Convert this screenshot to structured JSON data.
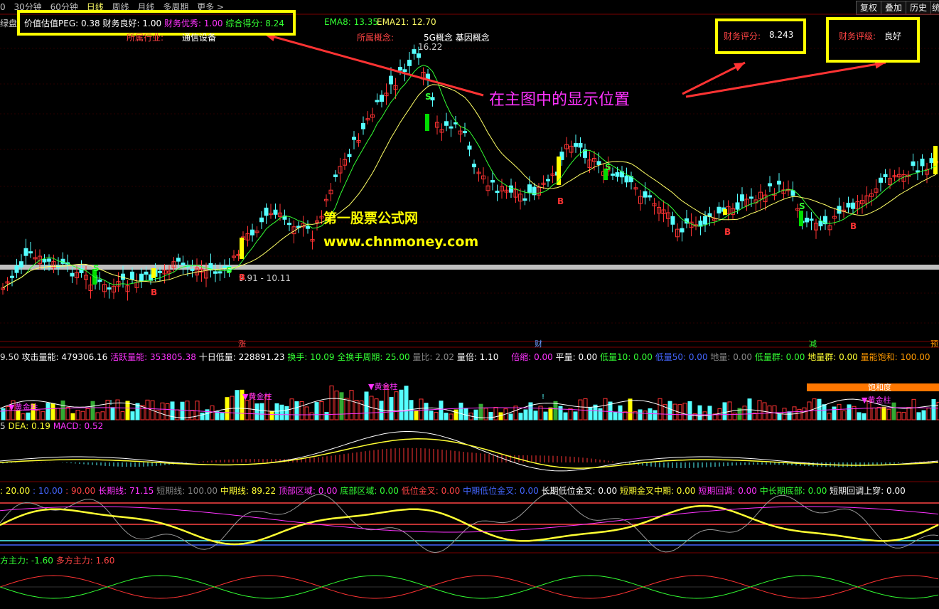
{
  "topbar": {
    "left_label": "0",
    "periods": [
      "30分钟",
      "60分钟",
      "日线",
      "周线",
      "月线",
      "多周期",
      "更多 >"
    ],
    "selected_period": "日线",
    "right_buttons": [
      "复权",
      "叠加",
      "历史",
      "统"
    ]
  },
  "main": {
    "side_label": "绿盘",
    "info_items": [
      {
        "text": "价值估值PEG: 0.38",
        "color": "#ffffff"
      },
      {
        "text": "财务良好: 1.00",
        "color": "#ffffff"
      },
      {
        "text": "财务优秀: 1.00",
        "color": "#ff33ff"
      },
      {
        "text": "综合得分: 8.24",
        "color": "#33ff33"
      }
    ],
    "ema8": "EMA8: 13.35",
    "ema21": "EMA21: 12.70",
    "industry_label": "所属行业:",
    "industry_value": "通信设备",
    "concept_label": "所属概念:",
    "concept_value": "5G概念 基因概念",
    "high_price": "16.22",
    "range_label": "9.91 - 10.11",
    "fin_score_label": "财务评分:",
    "fin_score_value": "8.243",
    "fin_rating_label": "财务评级:",
    "fin_rating_value": "良好",
    "annotation": "在主图中的显示位置",
    "watermark_cn": "第一股票公式网",
    "watermark_url": "www.chnmoney.com",
    "signals": [
      "S",
      "B",
      "S",
      "B",
      "S",
      "B",
      "S",
      "B",
      "S",
      "B"
    ],
    "bottom_tags": [
      "涨",
      "财",
      "减",
      "预"
    ]
  },
  "volume_panel": {
    "items": [
      {
        "text": "9.50",
        "color": "#dddddd"
      },
      {
        "text": "攻击量能: 479306.16",
        "color": "#ffffff"
      },
      {
        "text": "活跃量能: 353805.38",
        "color": "#ff33ff"
      },
      {
        "text": "十日低量: 228891.23",
        "color": "#ffffff"
      },
      {
        "text": "换手: 10.09",
        "color": "#33ff33"
      },
      {
        "text": "全换手周期: 25.00",
        "color": "#33ff33"
      },
      {
        "text": "量比: 2.02",
        "color": "#888888"
      },
      {
        "text": "量倍: 1.10",
        "color": "#ffffff"
      },
      {
        "text": "倍缩: 0.00",
        "color": "#ff33ff"
      },
      {
        "text": "平量: 0.00",
        "color": "#ffffff"
      },
      {
        "text": "低量10: 0.00",
        "color": "#33ff33"
      },
      {
        "text": "低量50: 0.00",
        "color": "#4466ff"
      },
      {
        "text": "地量: 0.00",
        "color": "#888888"
      },
      {
        "text": "低量群: 0.00",
        "color": "#33ff33"
      },
      {
        "text": "地量群: 0.00",
        "color": "#ffff33"
      },
      {
        "text": "量能饱和: 100.00",
        "color": "#ff9900"
      }
    ],
    "gold_label": "▼黄金柱",
    "saturation_label": "饱和度",
    "mark": "!"
  },
  "macd_panel": {
    "items": [
      {
        "text": "5",
        "color": "#dddddd"
      },
      {
        "text": "DEA: 0.19",
        "color": "#ffff33"
      },
      {
        "text": "MACD: 0.52",
        "color": "#ff33ff"
      }
    ]
  },
  "kdj_panel": {
    "items": [
      {
        "text": ": 20.00",
        "color": "#ffff33"
      },
      {
        "text": ": 10.00",
        "color": "#4466ff"
      },
      {
        "text": ": 90.00",
        "color": "#ff4444"
      },
      {
        "text": "长期线: 71.15",
        "color": "#ff33ff"
      },
      {
        "text": "短期线: 100.00",
        "color": "#888888"
      },
      {
        "text": "中期线: 89.22",
        "color": "#ffff33"
      },
      {
        "text": "顶部区域: 0.00",
        "color": "#ff33ff"
      },
      {
        "text": "底部区域: 0.00",
        "color": "#33ff33"
      },
      {
        "text": "低位金叉: 0.00",
        "color": "#ff4444"
      },
      {
        "text": "中期低位金叉: 0.00",
        "color": "#4466ff"
      },
      {
        "text": "长期低位金叉: 0.00",
        "color": "#ffffff"
      },
      {
        "text": "短期金叉中期: 0.00",
        "color": "#ffff33"
      },
      {
        "text": "短期回调: 0.00",
        "color": "#ff33ff"
      },
      {
        "text": "中长期底部: 0.00",
        "color": "#33ff33"
      },
      {
        "text": "短期回调上穿: 0.00",
        "color": "#ffffff"
      }
    ]
  },
  "force_panel": {
    "items": [
      {
        "text": "方主力: -1.60",
        "color": "#33ff33"
      },
      {
        "text": "多方主力: 1.60",
        "color": "#ff4444"
      }
    ]
  }
}
